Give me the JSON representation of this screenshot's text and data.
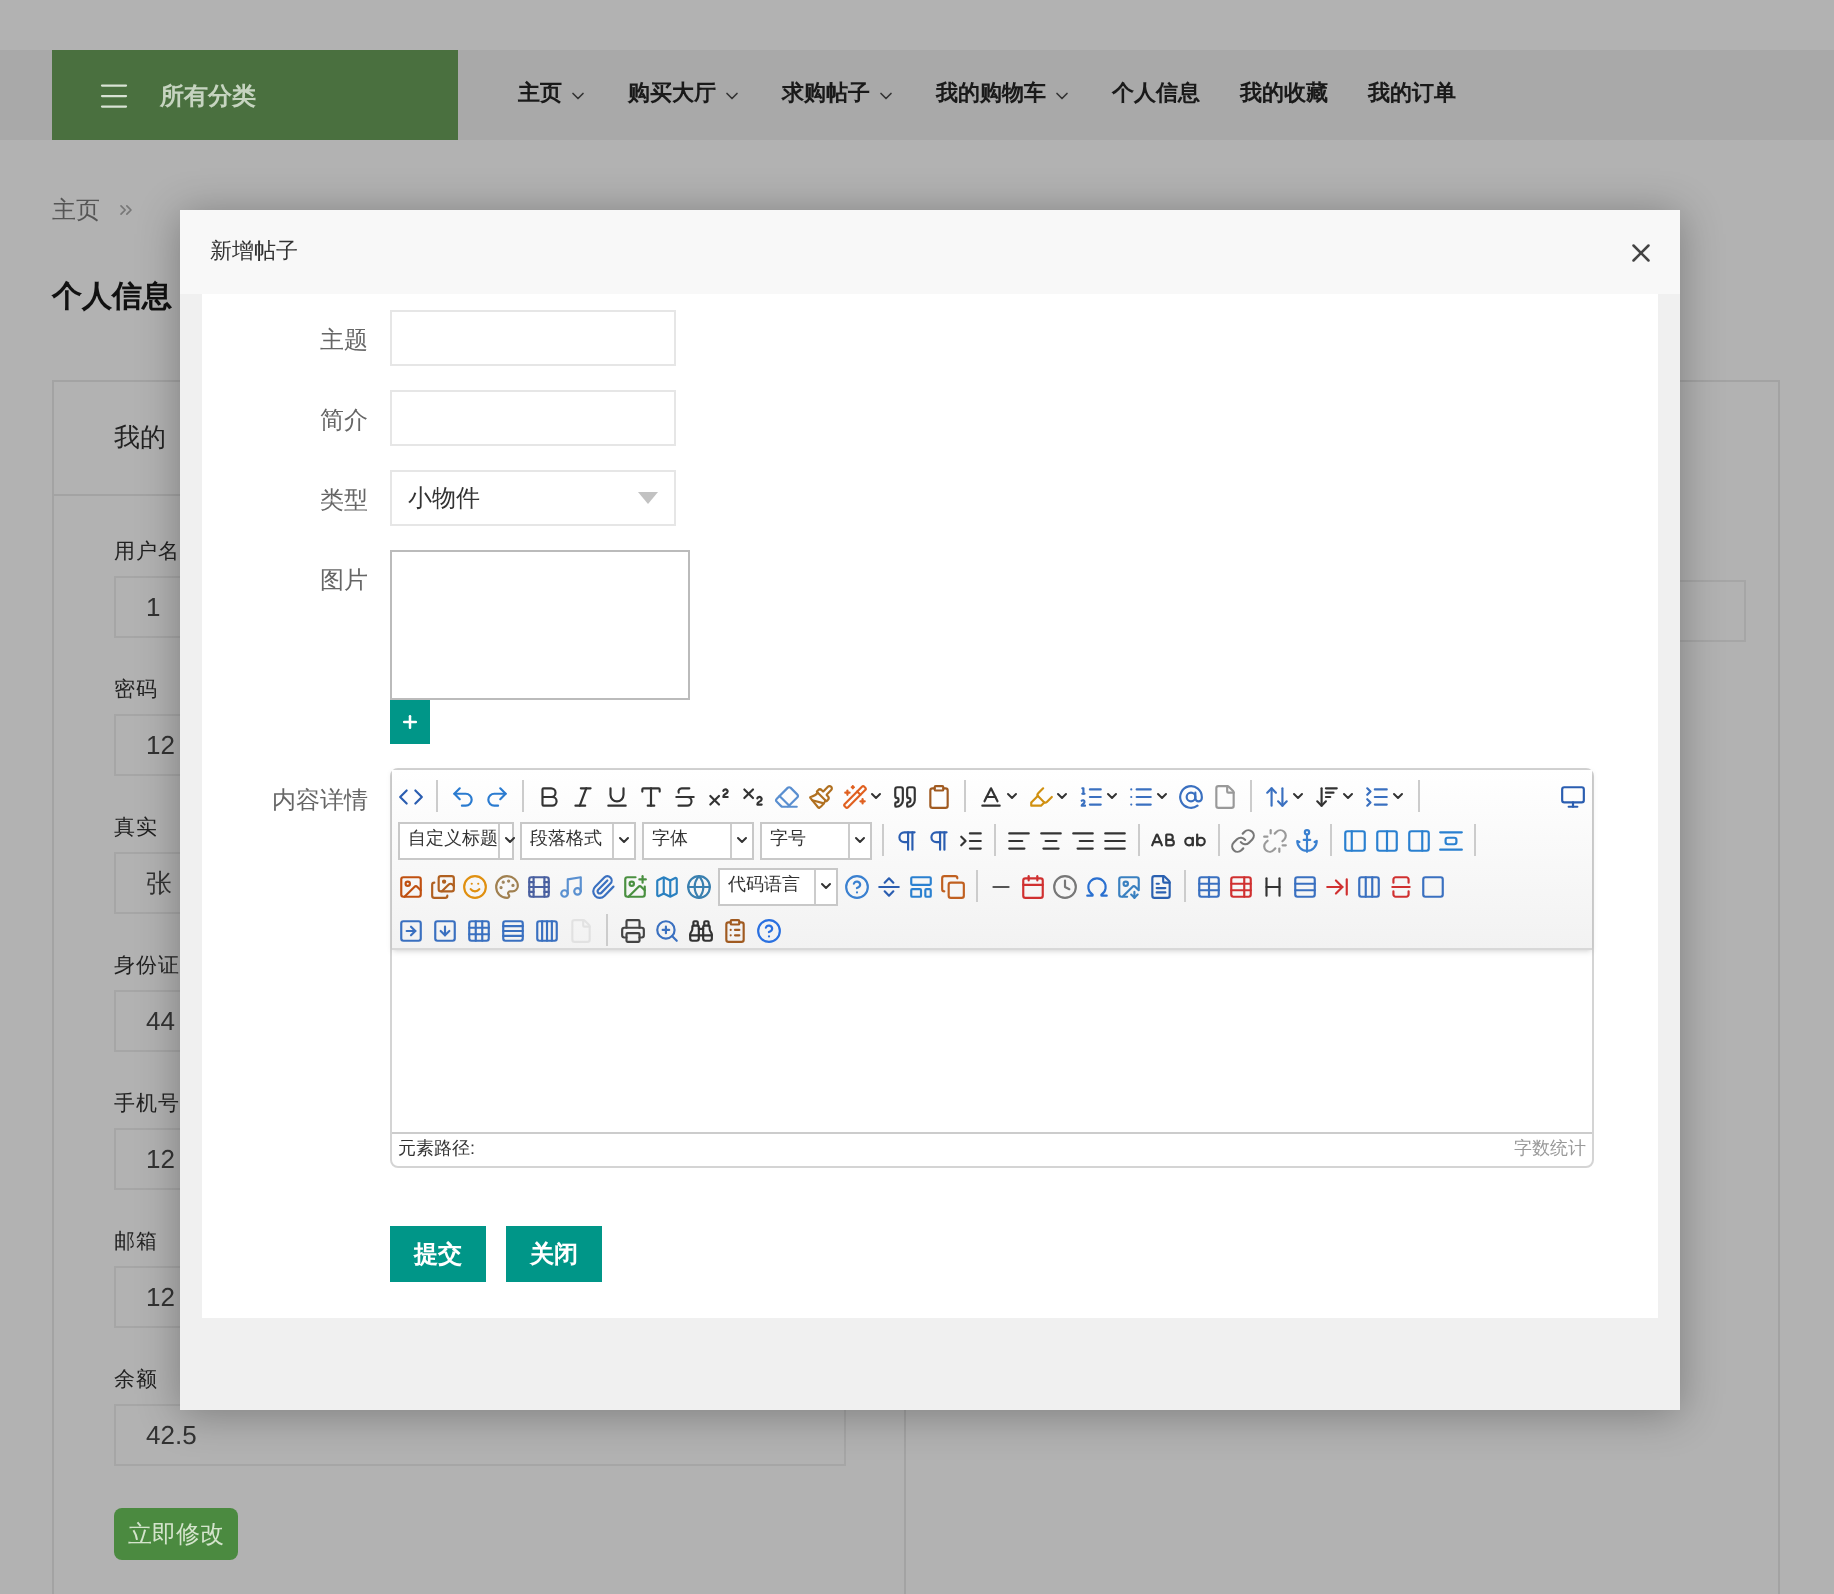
{
  "header": {
    "category_button": "所有分类",
    "nav": [
      {
        "label": "主页",
        "dropdown": true
      },
      {
        "label": "购买大厅",
        "dropdown": true
      },
      {
        "label": "求购帖子",
        "dropdown": true
      },
      {
        "label": "我的购物车",
        "dropdown": true
      },
      {
        "label": "个人信息",
        "dropdown": false
      },
      {
        "label": "我的收藏",
        "dropdown": false
      },
      {
        "label": "我的订单",
        "dropdown": false
      }
    ]
  },
  "breadcrumb": [
    "主页"
  ],
  "page_title": "个人信息",
  "profile_card": {
    "title": "我的",
    "fields": [
      {
        "label": "用户名",
        "value": "1"
      },
      {
        "label": "密码",
        "value": "12"
      },
      {
        "label": "真实",
        "value": "张"
      },
      {
        "label": "身份证",
        "value": "44"
      },
      {
        "label": "手机号",
        "value": "12"
      },
      {
        "label": "邮箱",
        "value": "12"
      },
      {
        "label": "余额",
        "value": "42.5"
      }
    ],
    "submit": "立即修改"
  },
  "dialog": {
    "title": "新增帖子",
    "fields": [
      {
        "kind": "text",
        "label": "主题"
      },
      {
        "kind": "text",
        "label": "简介"
      },
      {
        "kind": "select",
        "label": "类型",
        "value": "小物件"
      },
      {
        "kind": "image",
        "label": "图片"
      },
      {
        "kind": "editor",
        "label": "内容详情"
      }
    ],
    "editor": {
      "selects": [
        "自定义标题",
        "段落格式",
        "字体",
        "字号"
      ],
      "code_language": "代码语言",
      "path_label": "元素路径:",
      "word_count": "字数统计"
    },
    "buttons": [
      "提交",
      "关闭"
    ]
  }
}
